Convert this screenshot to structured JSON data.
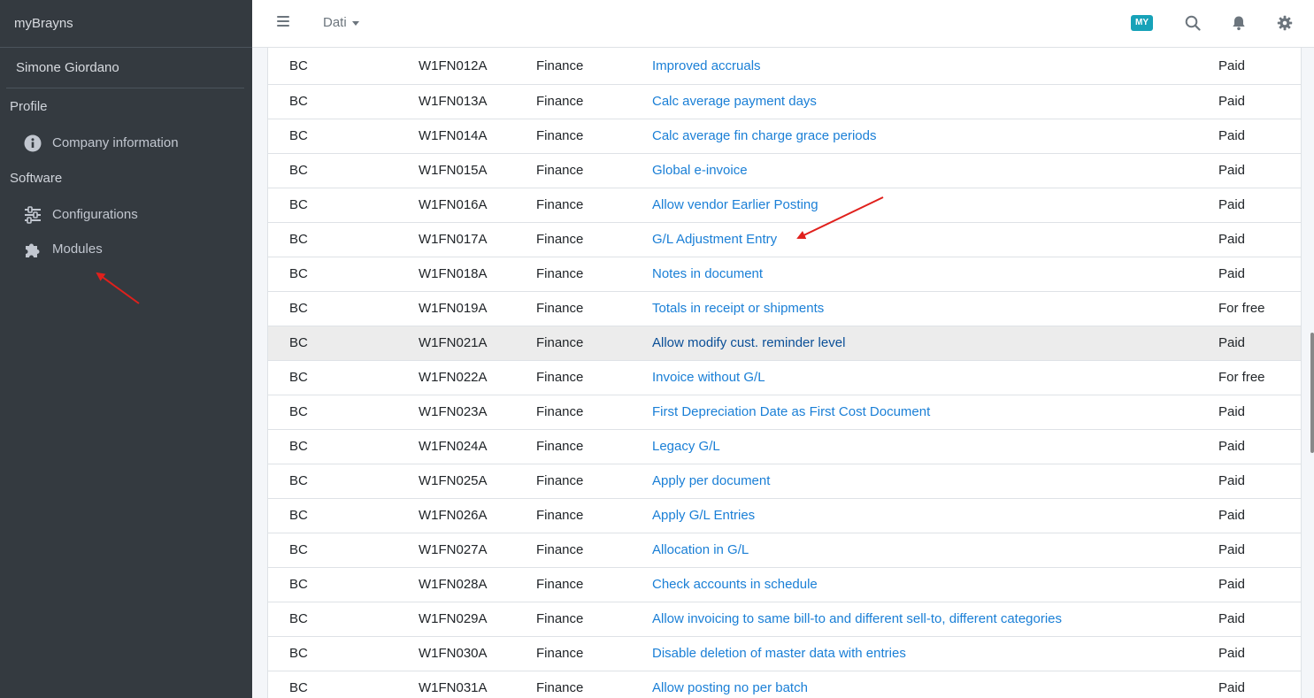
{
  "sidebar": {
    "brand": "myBrayns",
    "user_name": "Simone Giordano",
    "sections": [
      {
        "header": "Profile",
        "items": [
          {
            "label": "Company information",
            "icon": "info-circle-icon"
          }
        ]
      },
      {
        "header": "Software",
        "items": [
          {
            "label": "Configurations",
            "icon": "sliders-icon"
          },
          {
            "label": "Modules",
            "icon": "puzzle-icon"
          }
        ]
      }
    ]
  },
  "topbar": {
    "dropdown_label": "Dati",
    "badge_label": "MY",
    "badge_color": "#17a2b8",
    "icons": [
      "search-icon",
      "bell-icon",
      "gear-icon"
    ]
  },
  "table": {
    "rows": [
      {
        "product": "BC",
        "code": "W1FN012A",
        "area": "Finance",
        "name": "Improved accruals",
        "license": "Paid"
      },
      {
        "product": "BC",
        "code": "W1FN013A",
        "area": "Finance",
        "name": "Calc average payment days",
        "license": "Paid"
      },
      {
        "product": "BC",
        "code": "W1FN014A",
        "area": "Finance",
        "name": "Calc average fin charge grace periods",
        "license": "Paid"
      },
      {
        "product": "BC",
        "code": "W1FN015A",
        "area": "Finance",
        "name": "Global e-invoice",
        "license": "Paid"
      },
      {
        "product": "BC",
        "code": "W1FN016A",
        "area": "Finance",
        "name": "Allow vendor Earlier Posting",
        "license": "Paid"
      },
      {
        "product": "BC",
        "code": "W1FN017A",
        "area": "Finance",
        "name": "G/L Adjustment Entry",
        "license": "Paid"
      },
      {
        "product": "BC",
        "code": "W1FN018A",
        "area": "Finance",
        "name": "Notes in document",
        "license": "Paid"
      },
      {
        "product": "BC",
        "code": "W1FN019A",
        "area": "Finance",
        "name": "Totals in receipt or shipments",
        "license": "For free"
      },
      {
        "product": "BC",
        "code": "W1FN021A",
        "area": "Finance",
        "name": "Allow modify cust. reminder level",
        "license": "Paid"
      },
      {
        "product": "BC",
        "code": "W1FN022A",
        "area": "Finance",
        "name": "Invoice without G/L",
        "license": "For free"
      },
      {
        "product": "BC",
        "code": "W1FN023A",
        "area": "Finance",
        "name": "First Depreciation Date as First Cost Document",
        "license": "Paid"
      },
      {
        "product": "BC",
        "code": "W1FN024A",
        "area": "Finance",
        "name": "Legacy G/L",
        "license": "Paid"
      },
      {
        "product": "BC",
        "code": "W1FN025A",
        "area": "Finance",
        "name": "Apply per document",
        "license": "Paid"
      },
      {
        "product": "BC",
        "code": "W1FN026A",
        "area": "Finance",
        "name": "Apply G/L Entries",
        "license": "Paid"
      },
      {
        "product": "BC",
        "code": "W1FN027A",
        "area": "Finance",
        "name": "Allocation in G/L",
        "license": "Paid"
      },
      {
        "product": "BC",
        "code": "W1FN028A",
        "area": "Finance",
        "name": "Check accounts in schedule",
        "license": "Paid"
      },
      {
        "product": "BC",
        "code": "W1FN029A",
        "area": "Finance",
        "name": "Allow invoicing to same bill-to and different sell-to, different categories",
        "license": "Paid"
      },
      {
        "product": "BC",
        "code": "W1FN030A",
        "area": "Finance",
        "name": "Disable deletion of master data with entries",
        "license": "Paid"
      },
      {
        "product": "BC",
        "code": "W1FN031A",
        "area": "Finance",
        "name": "Allow posting no per batch",
        "license": "Paid"
      }
    ],
    "hovered_row": 8
  },
  "annotations": {
    "arrow_color": "#e0201c"
  }
}
